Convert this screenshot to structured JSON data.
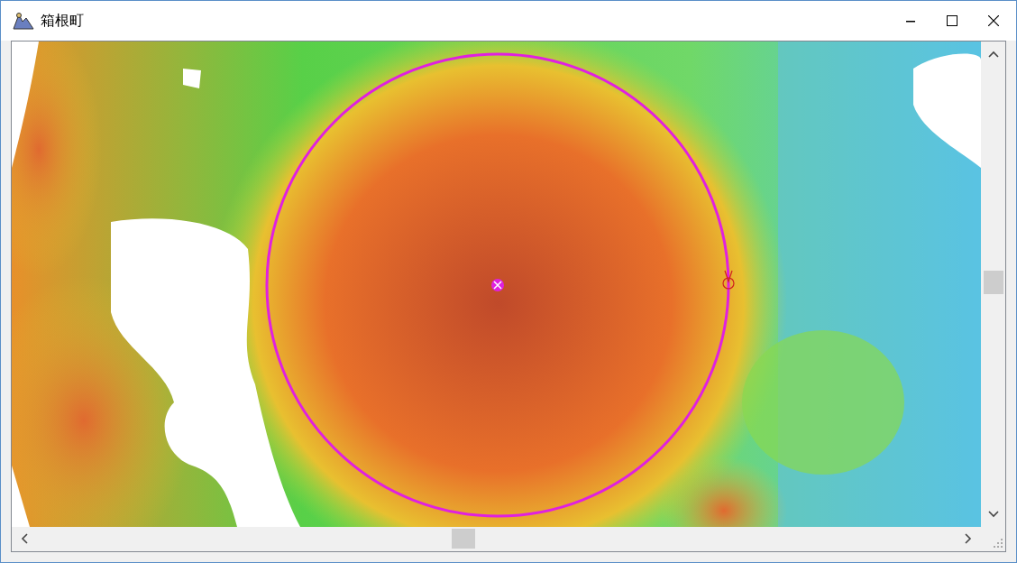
{
  "window": {
    "title": "箱根町"
  }
}
